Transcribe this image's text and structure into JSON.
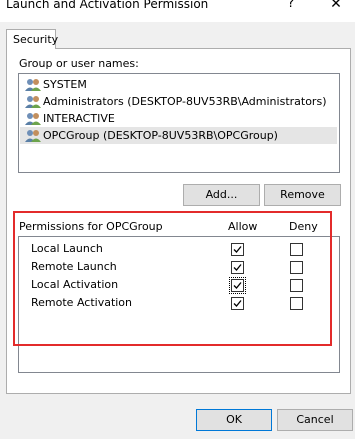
{
  "window": {
    "title": "Launch and Activation Permission",
    "help_glyph": "?",
    "close_glyph": "✕"
  },
  "tabs": [
    {
      "label": "Security"
    }
  ],
  "users_label": "Group or user names:",
  "users": [
    {
      "name": "SYSTEM",
      "icon": "users-icon"
    },
    {
      "name": "Administrators (DESKTOP-8UV53RB\\Administrators)",
      "icon": "users-icon"
    },
    {
      "name": "INTERACTIVE",
      "icon": "users-icon"
    },
    {
      "name": "OPCGroup (DESKTOP-8UV53RB\\OPCGroup)",
      "icon": "users-icon",
      "selected": true
    }
  ],
  "buttons": {
    "add": "Add...",
    "remove": "Remove",
    "ok": "OK",
    "cancel": "Cancel"
  },
  "permissions": {
    "header": "Permissions for OPCGroup",
    "allow_label": "Allow",
    "deny_label": "Deny",
    "rows": [
      {
        "name": "Local Launch",
        "allow": true,
        "deny": false
      },
      {
        "name": "Remote Launch",
        "allow": true,
        "deny": false
      },
      {
        "name": "Local Activation",
        "allow": true,
        "deny": false
      },
      {
        "name": "Remote Activation",
        "allow": true,
        "deny": false
      }
    ]
  },
  "highlight_color": "#e32b2b"
}
